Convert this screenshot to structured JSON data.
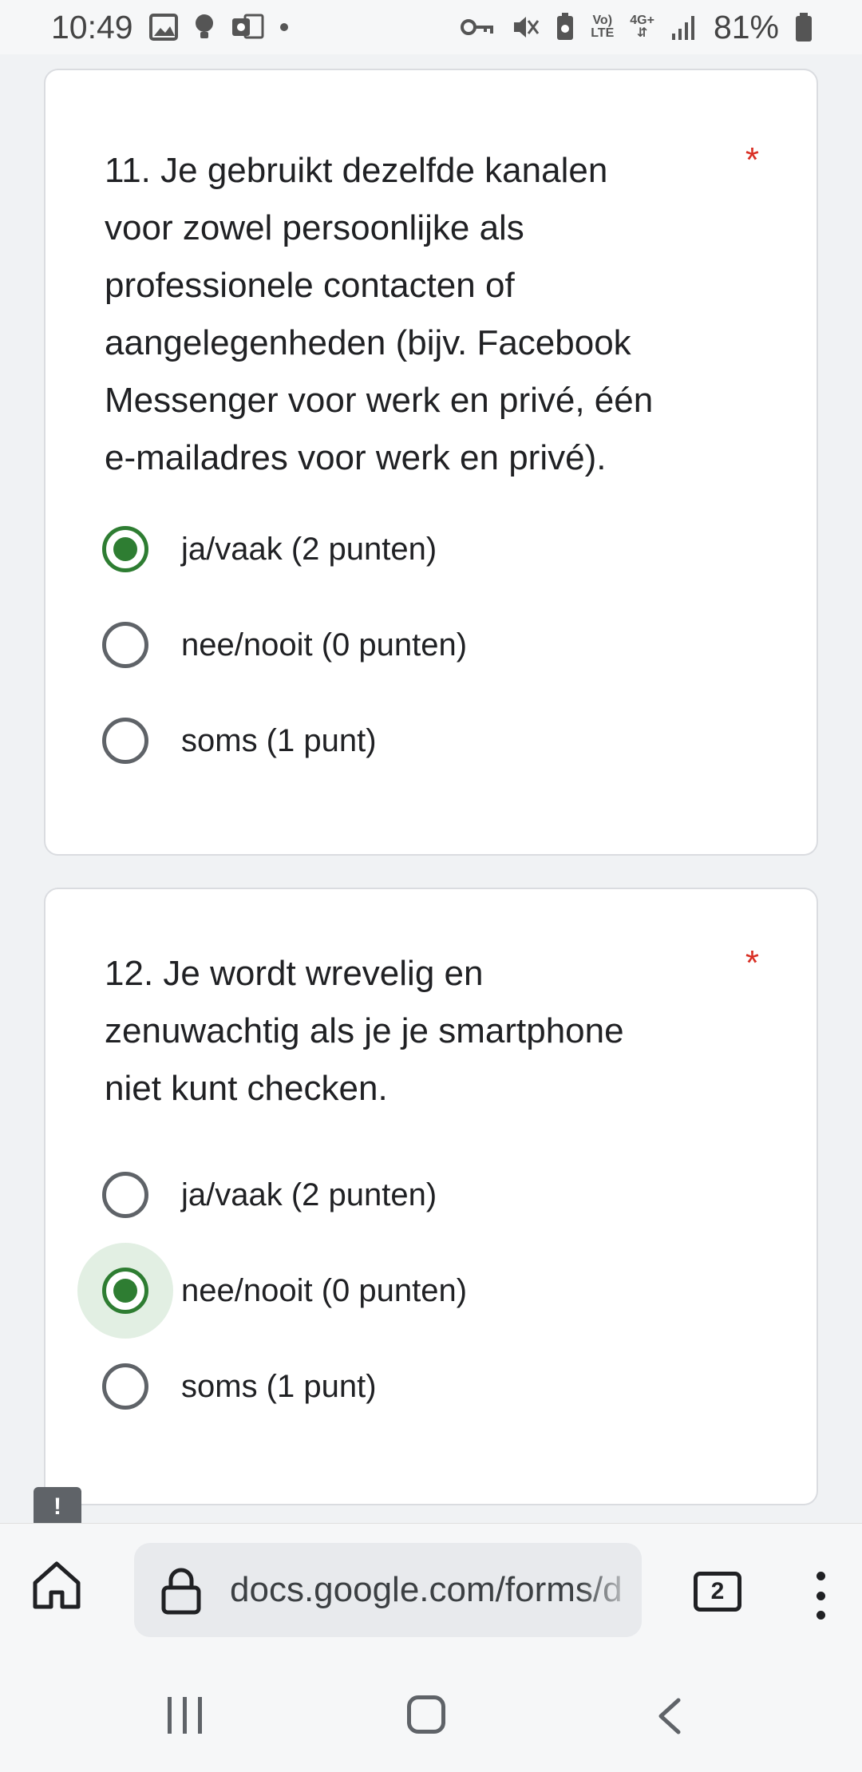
{
  "status_bar": {
    "time": "10:49",
    "battery_percent": "81%",
    "volte_top": "Vo)",
    "volte_bottom": "LTE",
    "network": "4G+",
    "icons": [
      "gallery-icon",
      "lightbulb-icon",
      "outlook-icon",
      "dot-icon",
      "vpn-key-icon",
      "mute-icon",
      "battery-saver-icon",
      "signal-icon",
      "battery-icon"
    ]
  },
  "form": {
    "questions": [
      {
        "title": "11. Je gebruikt dezelfde kanalen voor zowel persoonlijke als professionele contacten of aangelegenheden (bijv. Facebook Messenger voor werk en privé, één e-mailadres voor werk en privé).",
        "title_lines": [
          "11. Je gebruikt dezelfde kanalen",
          "voor zowel persoonlijke als",
          "professionele contacten of",
          "aangelegenheden (bijv. Facebook",
          "Messenger voor werk en privé, één",
          "e-mailadres voor werk en privé)."
        ],
        "required_marker": "*",
        "options": [
          "ja/vaak (2 punten)",
          "nee/nooit (0 punten)",
          "soms (1 punt)"
        ],
        "selected": "ja/vaak (2 punten)"
      },
      {
        "title": "12. Je wordt wrevelig en zenuwachtig als je je smartphone niet kunt checken.",
        "title_lines": [
          "12. Je wordt wrevelig en",
          "zenuwachtig als je je smartphone",
          "niet kunt checken."
        ],
        "required_marker": "*",
        "options": [
          "ja/vaak (2 punten)",
          "nee/nooit (0 punten)",
          "soms (1 punt)"
        ],
        "selected": "nee/nooit (0 punten)"
      }
    ],
    "feedback_badge": "!"
  },
  "browser": {
    "url": "docs.google.com/forms/d",
    "tab_count": "2"
  },
  "colors": {
    "accent_green": "#2e7d32",
    "required_red": "#d93025"
  }
}
